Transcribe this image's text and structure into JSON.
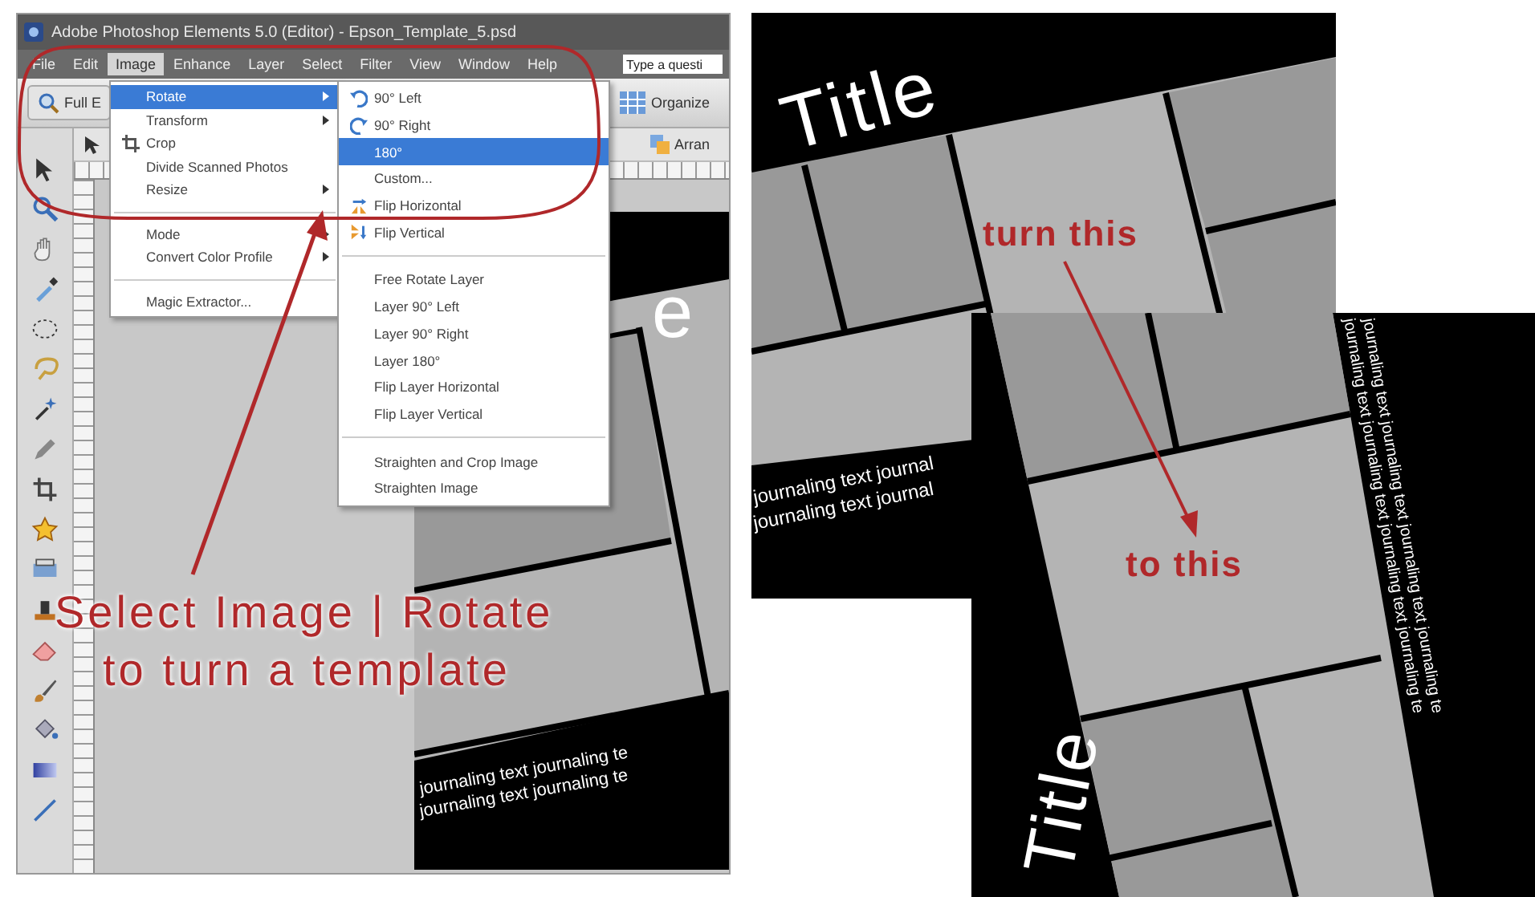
{
  "window": {
    "title": "Adobe Photoshop Elements 5.0 (Editor) - Epson_Template_5.psd"
  },
  "menu_bar": [
    {
      "label": "File",
      "selected": false
    },
    {
      "label": "Edit",
      "selected": false
    },
    {
      "label": "Image",
      "selected": true
    },
    {
      "label": "Enhance",
      "selected": false
    },
    {
      "label": "Layer",
      "selected": false
    },
    {
      "label": "Select",
      "selected": false
    },
    {
      "label": "Filter",
      "selected": false
    },
    {
      "label": "View",
      "selected": false
    },
    {
      "label": "Window",
      "selected": false
    },
    {
      "label": "Help",
      "selected": false
    }
  ],
  "help_search": {
    "placeholder": "Type a questi"
  },
  "toolbar": {
    "full_edit": "Full E",
    "organize": "Organize",
    "arrange": "Arran"
  },
  "image_menu": [
    {
      "label": "Rotate",
      "kind": "submenu",
      "selected": true
    },
    {
      "label": "Transform",
      "kind": "submenu",
      "selected": false
    },
    {
      "label": "Crop",
      "kind": "crop",
      "selected": false
    },
    {
      "label": "Divide Scanned Photos",
      "kind": "plain",
      "selected": false
    },
    {
      "label": "Resize",
      "kind": "submenu",
      "selected": false
    },
    {
      "kind": "separator"
    },
    {
      "label": "Mode",
      "kind": "submenu",
      "selected": false
    },
    {
      "label": "Convert Color Profile",
      "kind": "submenu",
      "selected": false
    },
    {
      "kind": "separator"
    },
    {
      "label": "Magic Extractor...",
      "kind": "plain",
      "selected": false
    }
  ],
  "rotate_submenu": [
    {
      "label": "90° Left",
      "kind": "rotate-left",
      "selected": false
    },
    {
      "label": "90° Right",
      "kind": "rotate-right",
      "selected": false
    },
    {
      "label": "180°",
      "kind": "plain",
      "selected": true
    },
    {
      "label": "Custom...",
      "kind": "plain",
      "selected": false
    },
    {
      "label": "Flip Horizontal",
      "kind": "flip-horizontal",
      "selected": false
    },
    {
      "label": "Flip Vertical",
      "kind": "flip-vertical",
      "selected": false
    },
    {
      "kind": "separator"
    },
    {
      "label": "Free Rotate Layer",
      "kind": "plain",
      "selected": false
    },
    {
      "label": "Layer 90° Left",
      "kind": "plain",
      "selected": false
    },
    {
      "label": "Layer 90° Right",
      "kind": "plain",
      "selected": false
    },
    {
      "label": "Layer 180°",
      "kind": "plain",
      "selected": false
    },
    {
      "label": "Flip Layer Horizontal",
      "kind": "plain",
      "selected": false
    },
    {
      "label": "Flip Layer Vertical",
      "kind": "plain",
      "selected": false
    },
    {
      "kind": "separator"
    },
    {
      "label": "Straighten and Crop Image",
      "kind": "plain",
      "selected": false
    },
    {
      "label": "Straighten Image",
      "kind": "plain",
      "selected": false
    }
  ],
  "canvas_template": {
    "title_fragment": "e",
    "journaling": [
      "journaling text journaling te",
      "journaling text journaling te"
    ]
  },
  "annotation": {
    "caption": [
      "Select Image | Rotate",
      "to turn a template"
    ]
  },
  "example_before": {
    "title": "Title",
    "journaling": [
      "journaling text journal",
      "journaling text journal"
    ],
    "label": "turn this"
  },
  "example_after": {
    "title": "Title",
    "journaling": [
      "journaling text journaling text journaling text journaling te",
      "journaling text journaling text journaling text journaling te"
    ],
    "label": "to this"
  }
}
